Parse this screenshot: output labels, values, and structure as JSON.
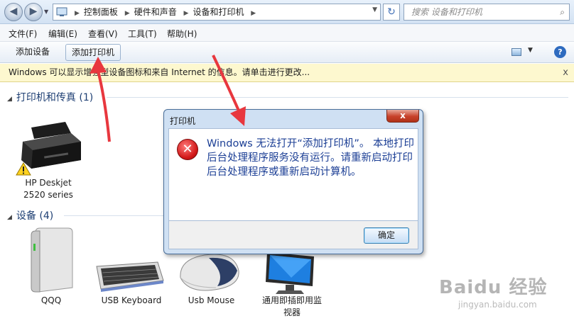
{
  "address_bar": {
    "breadcrumbs": [
      "控制面板",
      "硬件和声音",
      "设备和打印机"
    ],
    "search_placeholder": "搜索 设备和打印机"
  },
  "menu": {
    "items": [
      "文件(F)",
      "编辑(E)",
      "查看(V)",
      "工具(T)",
      "帮助(H)"
    ]
  },
  "command_bar": {
    "add_device": "添加设备",
    "add_printer": "添加打印机",
    "help": "?"
  },
  "info_bar": {
    "text": "Windows 可以显示增强型设备图标和来自 Internet 的信息。请单击进行更改...",
    "close": "x"
  },
  "groups": {
    "printers": {
      "title": "打印机和传真 (1)",
      "items": [
        {
          "label_line1": "HP Deskjet",
          "label_line2": "2520 series"
        }
      ]
    },
    "devices": {
      "title": "设备 (4)",
      "items": [
        {
          "label": "QQQ"
        },
        {
          "label": "USB Keyboard"
        },
        {
          "label": "Usb Mouse"
        },
        {
          "label_line1": "通用即插即用监",
          "label_line2": "视器"
        }
      ]
    }
  },
  "dialog": {
    "title": "打印机",
    "close": "x",
    "message": "Windows 无法打开“添加打印机”。 本地打印后台处理程序服务没有运行。请重新启动打印后台处理程序或重新启动计算机。",
    "ok_label": "确定",
    "error_glyph": "✕"
  },
  "watermark": {
    "brand": "Baidu 经验",
    "url": "jingyan.baidu.com"
  },
  "colors": {
    "annotation_arrow": "#e8373e",
    "dialog_message": "#1c3f95",
    "info_bar": "#fdf8cf"
  }
}
